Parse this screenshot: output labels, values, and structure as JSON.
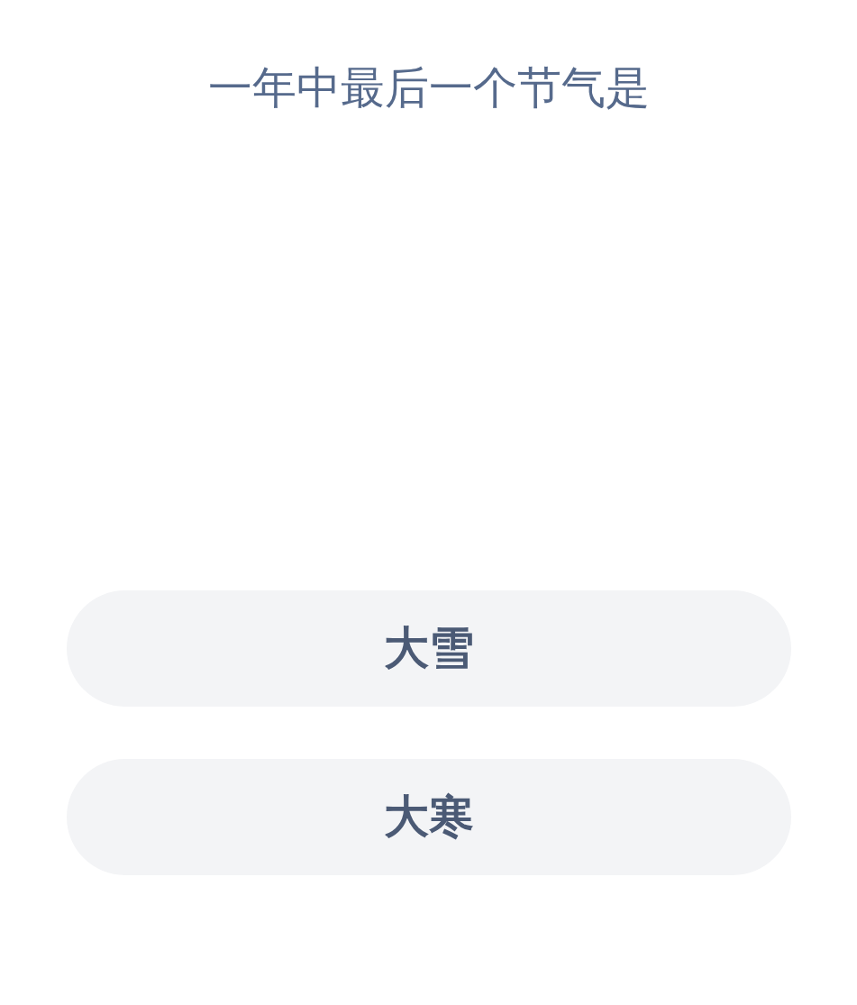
{
  "question": "一年中最后一个节气是",
  "options": [
    {
      "label": "大雪"
    },
    {
      "label": "大寒"
    }
  ]
}
